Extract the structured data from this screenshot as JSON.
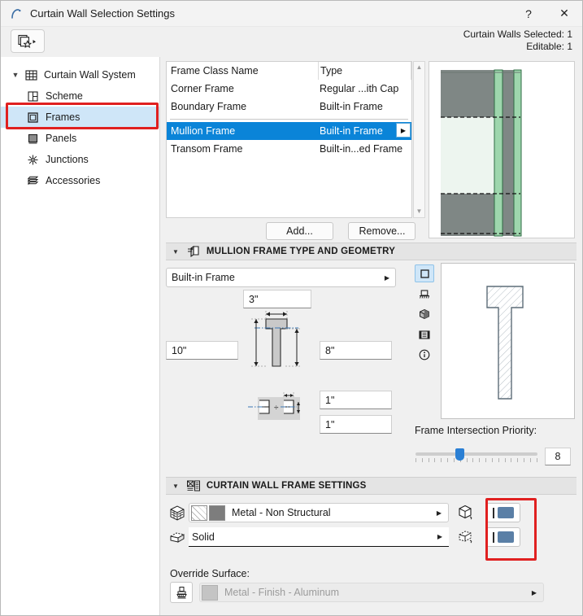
{
  "window": {
    "title": "Curtain Wall Selection Settings",
    "help_label": "?",
    "close_label": "✕",
    "app_icon": "archicad-icon"
  },
  "toolbar": {
    "favorites_icon": "favorites-star-icon",
    "selected_count_line": "Curtain Walls Selected: 1",
    "editable_line": "Editable: 1"
  },
  "sidebar": {
    "root": {
      "label": "Curtain Wall System",
      "icon": "grid-icon",
      "expanded": true
    },
    "items": [
      {
        "label": "Scheme",
        "icon": "scheme-icon",
        "selected": false
      },
      {
        "label": "Frames",
        "icon": "frame-icon",
        "selected": true
      },
      {
        "label": "Panels",
        "icon": "panel-icon",
        "selected": false
      },
      {
        "label": "Junctions",
        "icon": "junction-icon",
        "selected": false
      },
      {
        "label": "Accessories",
        "icon": "accessories-icon",
        "selected": false
      }
    ]
  },
  "frame_list": {
    "columns": [
      "Frame Class Name",
      "Type"
    ],
    "rows": [
      {
        "name": "Corner Frame",
        "type": "Regular ...ith Cap",
        "selected": false
      },
      {
        "name": "Boundary Frame",
        "type": "Built-in Frame",
        "selected": false
      },
      {
        "name": "Mullion Frame",
        "type": "Built-in Frame",
        "selected": true
      },
      {
        "name": "Transom Frame",
        "type": "Built-in...ed Frame",
        "selected": false
      }
    ],
    "row_expand_icon": "chevron-right-icon",
    "scroll_up_icon": "scroll-up-arrow-icon",
    "scroll_down_icon": "scroll-down-arrow-icon",
    "add_button": "Add...",
    "remove_button": "Remove..."
  },
  "geometry_section": {
    "title": "MULLION FRAME TYPE AND GEOMETRY",
    "icon": "mullion-geometry-icon",
    "collapse_icon": "triangle-down-icon",
    "frame_type": "Built-in Frame",
    "frame_type_carat": "chevron-right-icon",
    "width_value": "3\"",
    "left_depth_value": "10\"",
    "right_depth_value": "8\"",
    "offset_top_value": "1\"",
    "offset_bottom_value": "1\"",
    "view_icons": [
      {
        "name": "2d-symbol-icon",
        "active": true
      },
      {
        "name": "section-view-icon",
        "active": false
      },
      {
        "name": "3d-view-icon",
        "active": false
      },
      {
        "name": "list-view-icon",
        "active": false
      },
      {
        "name": "info-icon",
        "active": false
      }
    ],
    "priority_label": "Frame Intersection Priority:",
    "priority_value": "8"
  },
  "frame_settings_section": {
    "title": "CURTAIN WALL FRAME SETTINGS",
    "icon": "frame-settings-icon",
    "collapse_icon": "triangle-down-icon",
    "building_material": {
      "row_icon": "building-material-icon",
      "value": "Metal - Non Structural",
      "carat": "chevron-right-icon",
      "end_icon": "3d-box-icon",
      "toggle_name": "pen-fill-toggle"
    },
    "fill": {
      "row_icon": "cut-fill-icon",
      "value": "Solid",
      "carat": "chevron-right-icon",
      "end_icon": "3d-cut-box-icon",
      "toggle_name": "pen-fill-toggle"
    },
    "override_surface": {
      "label": "Override Surface:",
      "brush_icon": "paint-brush-icon",
      "value": "Metal - Finish - Aluminum",
      "carat": "chevron-right-icon",
      "enabled": false
    }
  },
  "annotations": {
    "highlight_color": "#e02020",
    "boxes": [
      "sidebar-frames-item",
      "frame-settings-toggles"
    ]
  },
  "colors": {
    "selection_blue": "#0a84d8",
    "sidebar_selection": "#cfe6f8",
    "window_bg": "#f0f0f0",
    "slider_blue": "#2a7fd4",
    "toggle_blue": "#5a7fa6"
  }
}
